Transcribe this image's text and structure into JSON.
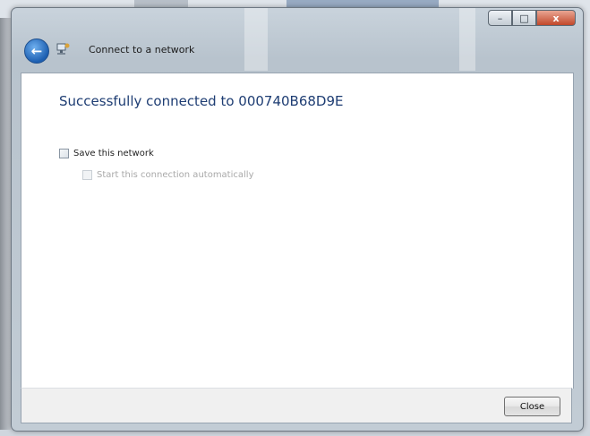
{
  "window": {
    "title": "Connect to a network",
    "caption": {
      "minimize_glyph": "–",
      "maximize_glyph": "□",
      "close_glyph": "x"
    }
  },
  "content": {
    "headline": "Successfully connected to 000740B68D9E",
    "save_network": {
      "label": "Save this network",
      "checked": false
    },
    "start_automatically": {
      "label": "Start this connection automatically",
      "checked": false,
      "enabled": false
    }
  },
  "footer": {
    "close_label": "Close"
  },
  "icons": {
    "back": "back-arrow-icon",
    "network": "network-icon"
  },
  "colors": {
    "headline": "#1e3d73",
    "close_caption": "#c2472a"
  }
}
